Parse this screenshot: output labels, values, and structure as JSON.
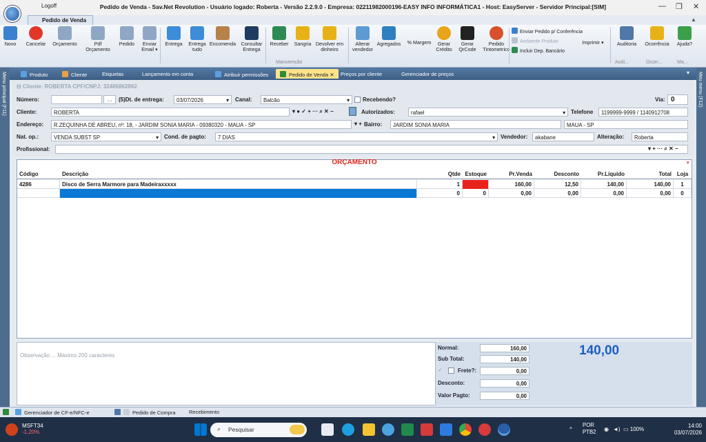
{
  "window": {
    "logoff": "Logoff",
    "title": "Pedido de Venda - Sav.Net Revolution - Usuário logado: Roberta - Versão 2.2.9.0 - Empresa: 02211982000196-EASY INFO INFORMÁTICA1 - Host: EasyServer - Servidor Principal:[SIM]",
    "menu_tab": "Pedido de Venda"
  },
  "ribbon": {
    "buttons": [
      {
        "label": "Novo",
        "color": "#3b7fd0"
      },
      {
        "label": "Cancelar",
        "color": "#e2362b"
      },
      {
        "label": "Orçamento",
        "color": "#8fa7c4"
      },
      {
        "label": "Pdf Orçamento",
        "color": "#8fa7c4"
      },
      {
        "label": "Pedido",
        "color": "#8fa7c4"
      },
      {
        "label": "Enviar Email ▾",
        "color": "#8fa7c4"
      },
      {
        "label": "Entrega",
        "color": "#3c8cd8"
      },
      {
        "label": "Entrega tudo",
        "color": "#3c8cd8"
      },
      {
        "label": "Encomenda",
        "color": "#b78149"
      },
      {
        "label": "Consultar Entrega",
        "color": "#1f3b5f"
      },
      {
        "label": "Receber",
        "color": "#2d8a53"
      },
      {
        "label": "Sangria",
        "color": "#e7b218"
      },
      {
        "label": "Devolver em dinheiro",
        "color": "#e7b218"
      },
      {
        "label": "Alterar vendedor",
        "color": "#5d9bd2"
      },
      {
        "label": "Agregados",
        "color": "#2f7fbf"
      },
      {
        "label": "% Margem",
        "color": ""
      },
      {
        "label": "Gerar Crédito",
        "color": "#e8a51b"
      },
      {
        "label": "Gerar QrCode",
        "color": "#222222"
      },
      {
        "label": "Pedido Tintometrico",
        "color": "#d9512c"
      },
      {
        "label": "Imprimir ▾",
        "color": ""
      },
      {
        "label": "Auditoria",
        "color": "#4f77a8"
      },
      {
        "label": "Ocorrência",
        "color": "#e7b218"
      },
      {
        "label": "Ajuda?",
        "color": "#3aa04a"
      }
    ],
    "group_label": "Manutenção",
    "side_options": [
      {
        "label": "Enviar Pedido p/ Conferência",
        "color": "#3b7fd0"
      },
      {
        "label": "Ambiente Produto",
        "color": "#b9c3cf"
      },
      {
        "label": "Incluir Dep. Bancário",
        "color": "#2d8a53"
      }
    ],
    "collapsed_groups": [
      "Audi...",
      "Ocorr...",
      "Ma..."
    ]
  },
  "side_menus": {
    "left": "Menu principal (F11)",
    "right": "Meu menu (F12)"
  },
  "tabs": [
    {
      "label": "Produto",
      "active": false,
      "color": "#5aa0e0"
    },
    {
      "label": "Cliente",
      "active": false,
      "color": "#e6a04a"
    },
    {
      "label": "Etiquetas",
      "active": false,
      "color": ""
    },
    {
      "label": "Lançamento em conta",
      "active": false,
      "color": ""
    },
    {
      "label": "Atribuir permissões",
      "active": false,
      "color": "#5aa0e0"
    },
    {
      "label": "Pedido de Venda",
      "active": true,
      "color": "#2f8a3a"
    },
    {
      "label": "Preços por cliente",
      "active": false,
      "color": ""
    },
    {
      "label": "Gerenciador de preços",
      "active": false,
      "color": ""
    }
  ],
  "form": {
    "cliente_header": "Cliente: ROBERTA CPF/CNPJ: 32486862862",
    "numero_label": "Número:",
    "numero_value": "",
    "dt_entrega_label": "(5)Dt. de entrega:",
    "dt_entrega_value": "03/07/2026",
    "canal_label": "Canal:",
    "canal_value": "Balcão",
    "recebendo_label": "Recebendo?",
    "via_label": "Via:",
    "via_value": "0",
    "cliente_label": "Cliente:",
    "cliente_value": "ROBERTA",
    "cliente_tools": "▾ ● ✓ + ··· ⌕ ✕ −",
    "autorizados_label": "Autorizados:",
    "autorizados_value": "rafael",
    "telefone_label": "Telefone",
    "telefone_value": "1199999-9999 / 1140912708",
    "endereco_label": "Endereço:",
    "endereco_value": "R.ZEQUINHA DE ABREU, nº: 18, - JARDIM SONIA MARIA - 09380320 - MAUA - SP",
    "endereco_tools": "▾ +",
    "bairro_label": "Bairro:",
    "bairro_value": "JARDIM SONIA MARIA",
    "cidade_value": "MAUA - SP",
    "natop_label": "Nat. op.:",
    "natop_value": "VENDA SUBST SP",
    "cond_label": "Cond. de pagto:",
    "cond_value": "7 DIAS",
    "vendedor_label": "Vendedor:",
    "vendedor_value": "akabane",
    "alteracao_label": "Alteração:",
    "alteracao_value": "Roberta",
    "profissional_label": "Profissional:",
    "profissional_value": "",
    "profissional_tools": "▾ + ··· ⌕ ✕ −"
  },
  "grid": {
    "title": "ORÇAMENTO",
    "columns": [
      "Código",
      "Descrição",
      "Qtde",
      "Estoque",
      "Pr.Venda",
      "Desconto",
      "Pr.Líquido",
      "Total",
      "Loja"
    ],
    "rows": [
      {
        "codigo": "4286",
        "descricao": "Disco de Serra Marmore para Madeiraxxxxx",
        "qtde": "1",
        "estoque": "0",
        "pr_venda": "160,00",
        "desconto": "12,50",
        "pr_liquido": "140,00",
        "total": "140,00",
        "loja": "1"
      },
      {
        "codigo": "",
        "descricao": "",
        "qtde": "0",
        "estoque": "0",
        "pr_venda": "0,00",
        "desconto": "0,00",
        "pr_liquido": "0,00",
        "total": "0,00",
        "loja": "0"
      }
    ],
    "stock_alert_color": "#e8231b",
    "selection_color": "#0a78d4"
  },
  "observacao_placeholder": "Observação ... Máximo 200 caracteres",
  "totals": {
    "normal_label": "Normal:",
    "normal_value": "160,00",
    "subtotal_label": "Sub Total:",
    "subtotal_value": "140,00",
    "frete_label": "Frete?:",
    "frete_value": "0,00",
    "desconto_label": "Desconto:",
    "desconto_value": "0,00",
    "valor_pagto_label": "Valor Pagto:",
    "valor_pagto_value": "0,00",
    "grand_total": "140,00"
  },
  "statusbar": {
    "items": [
      "Gerenciador de CF-e/NFC-e",
      "Pedido de Compra",
      "Recebimento"
    ]
  },
  "taskbar": {
    "stock_name": "MSFT34",
    "stock_change": "-1,20%",
    "search_placeholder": "Pesquisar",
    "lang_top": "POR",
    "lang_bottom": "PTB2",
    "battery": "100%",
    "time": "14:00",
    "date": "03/07/2026"
  }
}
